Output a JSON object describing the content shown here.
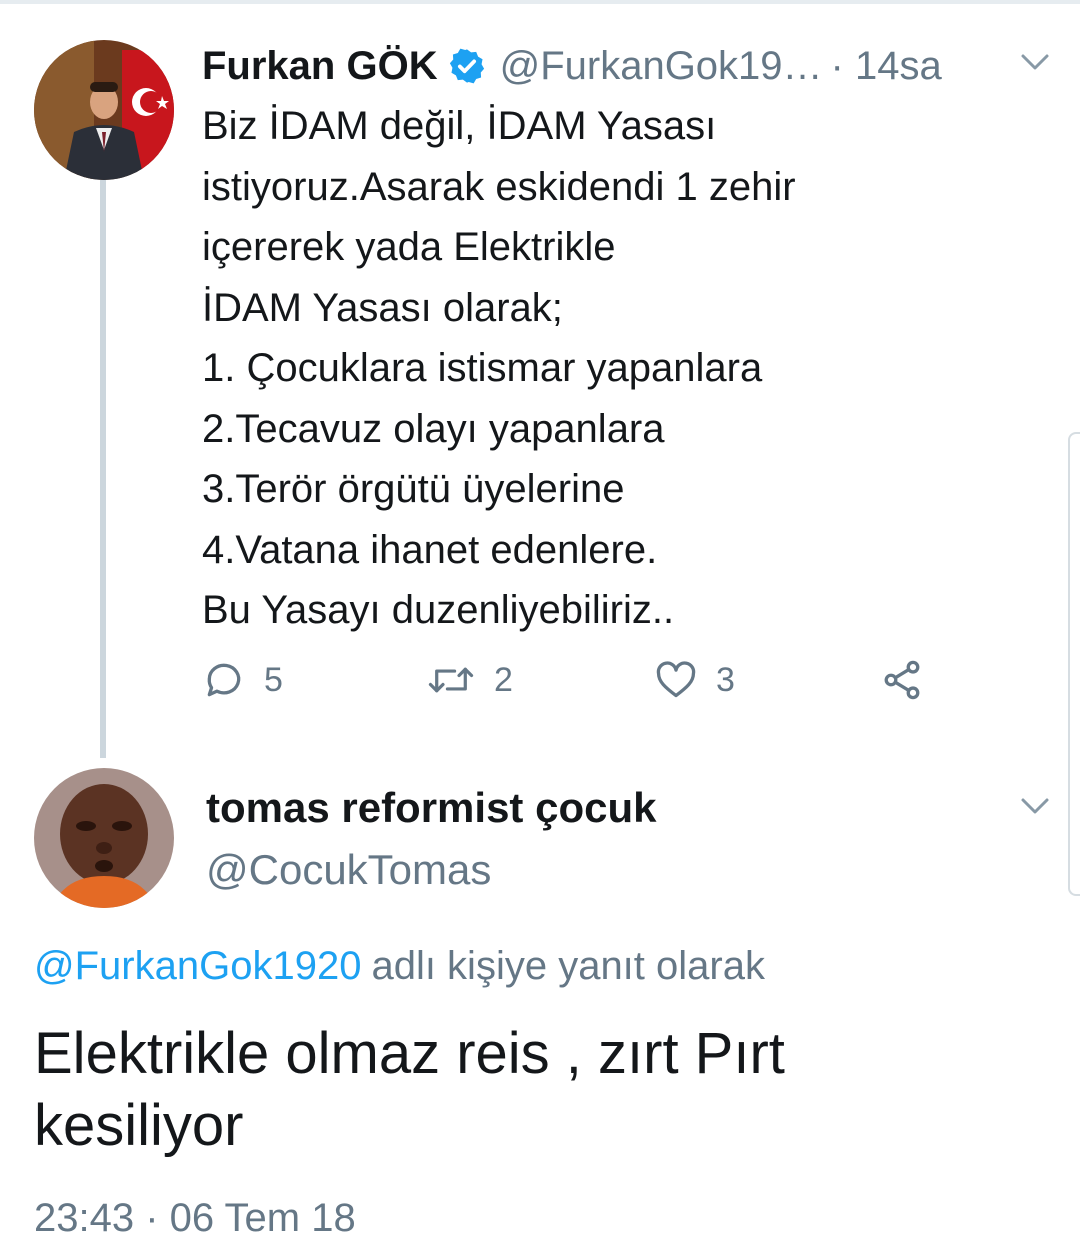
{
  "tweet1": {
    "author_name": "Furkan GÖK",
    "verified": true,
    "handle_truncated": "@FurkanGok19…",
    "time": "· 14sa",
    "lines": [
      "Biz İDAM değil, İDAM Yasası",
      "istiyoruz.Asarak eskidendi 1 zehir",
      "içererek yada Elektrikle",
      "İDAM Yasası olarak;",
      "1. Çocuklara istismar yapanlara",
      "2.Tecavuz olayı yapanlara",
      "3.Terör örgütü üyelerine",
      "4.Vatana ihanet edenlere.",
      "Bu Yasayı duzenliyebiliriz.."
    ],
    "actions": {
      "reply_count": "5",
      "retweet_count": "2",
      "like_count": "3"
    }
  },
  "tweet2": {
    "author_name": "tomas reformist çocuk",
    "handle": "@CocukTomas",
    "reply_to_mention": "@FurkanGok1920",
    "reply_to_suffix": "adlı kişiye yanıt olarak",
    "lines": [
      "Elektrikle olmaz reis , zırt Pırt",
      "kesiliyor"
    ],
    "timestamp": "23:43 · 06 Tem 18"
  },
  "colors": {
    "accent": "#1da1f2",
    "secondary_text": "#657786",
    "thread_line": "#ccd6dd"
  }
}
